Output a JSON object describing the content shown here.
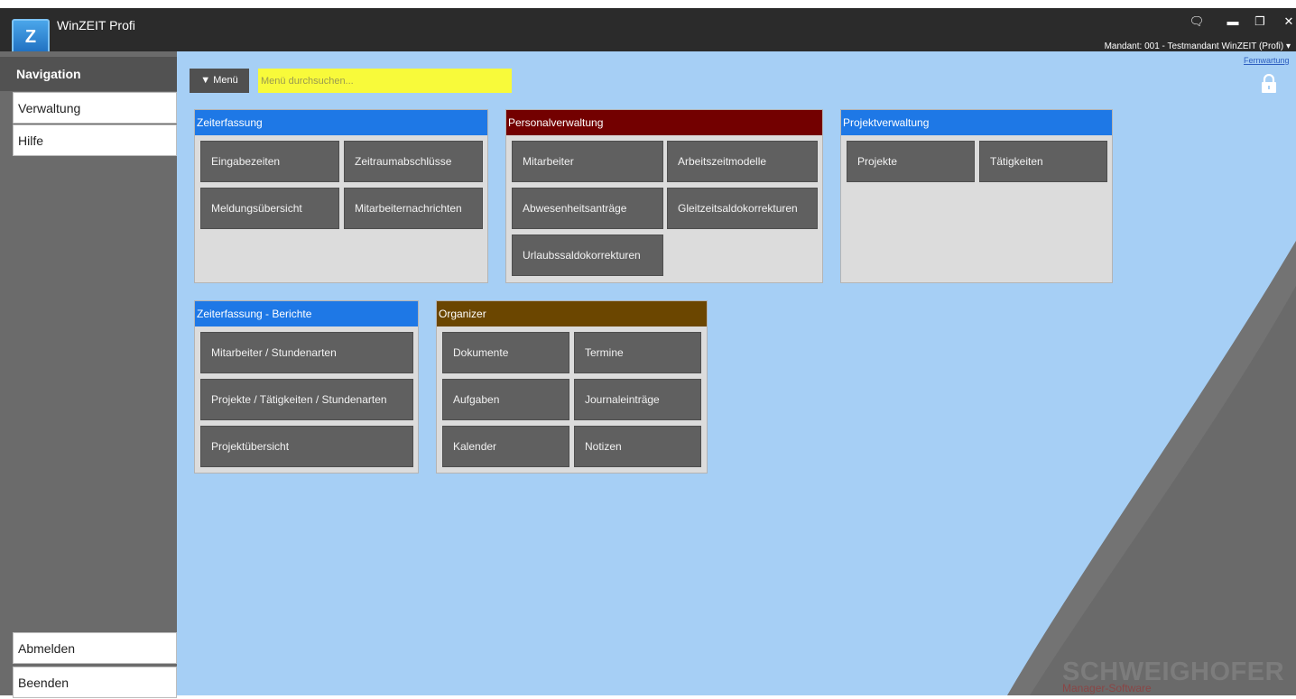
{
  "window": {
    "title": "WinZEIT Profi",
    "logo_text": "Z",
    "controls": [
      "🗨",
      "▬",
      "❐",
      "✕"
    ],
    "mandant": "Mandant: 001 - Testmandant WinZEIT (Profi) ▾"
  },
  "sidebar": {
    "header": "Navigation",
    "items": [
      {
        "label": "Verwaltung"
      },
      {
        "label": "Hilfe"
      }
    ],
    "bottom": [
      {
        "label": "Abmelden"
      },
      {
        "label": "Beenden"
      }
    ]
  },
  "toolbar": {
    "menu_label": "▼ Menü",
    "search_placeholder": "Menü durchsuchen...",
    "fernwartung": "Fernwartung"
  },
  "panels": [
    {
      "title": "Zeiterfassung",
      "color": "#1e78e6",
      "tiles": [
        "Eingabezeiten",
        "Zeitraumabschlüsse",
        "Meldungsübersicht",
        "Mitarbeiternachrichten"
      ]
    },
    {
      "title": "Personalverwaltung",
      "color": "#730000",
      "tiles": [
        "Mitarbeiter",
        "Arbeitszeitmodelle",
        "Abwesenheitsanträge",
        "Gleitzeitsaldokorrekturen",
        "Urlaubssaldokorrekturen"
      ]
    },
    {
      "title": "Projektverwaltung",
      "color": "#1e78e6",
      "tiles": [
        "Projekte",
        "Tätigkeiten"
      ]
    },
    {
      "title": "Zeiterfassung - Berichte",
      "color": "#1e78e6",
      "tiles": [
        "Mitarbeiter / Stundenarten",
        "Projekte / Tätigkeiten / Stundenarten",
        "Projektübersicht"
      ]
    },
    {
      "title": "Organizer",
      "color": "#6b4600",
      "tiles": [
        "Dokumente",
        "Termine",
        "Aufgaben",
        "Journaleinträge",
        "Kalender",
        "Notizen"
      ]
    }
  ],
  "brand": {
    "name": "SCHWEIGHOFER",
    "tagline": "Manager-Software"
  },
  "colors": {
    "content_bg": "#a6cff5",
    "sidebar_bg": "#6b6b6b",
    "search_bg": "#f8fa3a"
  }
}
